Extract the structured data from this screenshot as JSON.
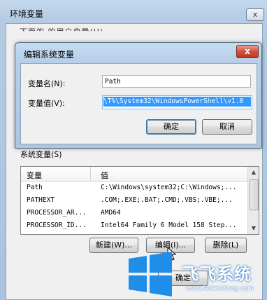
{
  "env_dialog": {
    "title": "环境变量",
    "close_symbol": "x",
    "user_vars_label": "下面的 的用户变量(U)",
    "system_vars_label": "系统变量(S)",
    "system_vars": {
      "columns": [
        "变量",
        "值"
      ],
      "rows": [
        {
          "name": "Path",
          "value": "C:\\Windows\\system32;C:\\Windows;..."
        },
        {
          "name": "PATHEXT",
          "value": ".COM;.EXE;.BAT;.CMD;.VBS;.VBE;..."
        },
        {
          "name": "PROCESSOR_AR...",
          "value": "AMD64"
        },
        {
          "name": "PROCESSOR_ID...",
          "value": "Intel64 Family 6 Model 158 Step..."
        }
      ]
    },
    "buttons": {
      "new": "新建(W)...",
      "edit": "编辑(I)...",
      "delete": "删除(L)",
      "ok": "确定"
    }
  },
  "edit_dialog": {
    "title": "编辑系统变量",
    "close_symbol": "x",
    "name_label": "变量名(N):",
    "value_label": "变量值(V):",
    "name_value": "Path",
    "value_value": "T%\\System32\\WindowsPowerShell\\v1.0\\",
    "buttons": {
      "ok": "确定",
      "cancel": "取消"
    }
  },
  "watermark": {
    "text": "飞飞系统",
    "url": "www.feifeixitong.com",
    "logo_icon": "windows-logo-icon"
  },
  "colors": {
    "selection": "#3399ff",
    "titlebar": "#b6cee8",
    "close_red": "#c03922",
    "watermark_blue": "#1e6fc2"
  }
}
